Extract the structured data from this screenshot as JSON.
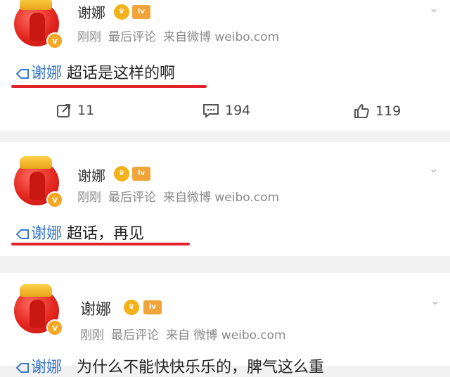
{
  "posts": [
    {
      "author": "谢娜",
      "time": "刚刚",
      "last_comment": "最后评论",
      "source": "来自微博 weibo.com",
      "topic": "谢娜",
      "text": "超话是这样的啊",
      "repost_count": "11",
      "comment_count": "194",
      "like_count": "119"
    },
    {
      "author": "谢娜",
      "time": "刚刚",
      "last_comment": "最后评论",
      "source": "来自微博 weibo.com",
      "topic": "谢娜",
      "text": "超话，再见"
    },
    {
      "author": "谢娜",
      "time": "刚刚",
      "last_comment": "最后评论",
      "source": "来自 微博 weibo.com",
      "topic": "谢娜",
      "text": "为什么不能快快乐乐的，脾气这么重"
    }
  ],
  "colors": {
    "topic": "#3a78c9",
    "underline": "#e2222a",
    "verified": "#f5a623"
  },
  "icons": {
    "topic": "topic-tag-icon",
    "repost": "repost-icon",
    "comment": "comment-icon",
    "like": "like-icon",
    "more": "chevron-down-icon"
  }
}
